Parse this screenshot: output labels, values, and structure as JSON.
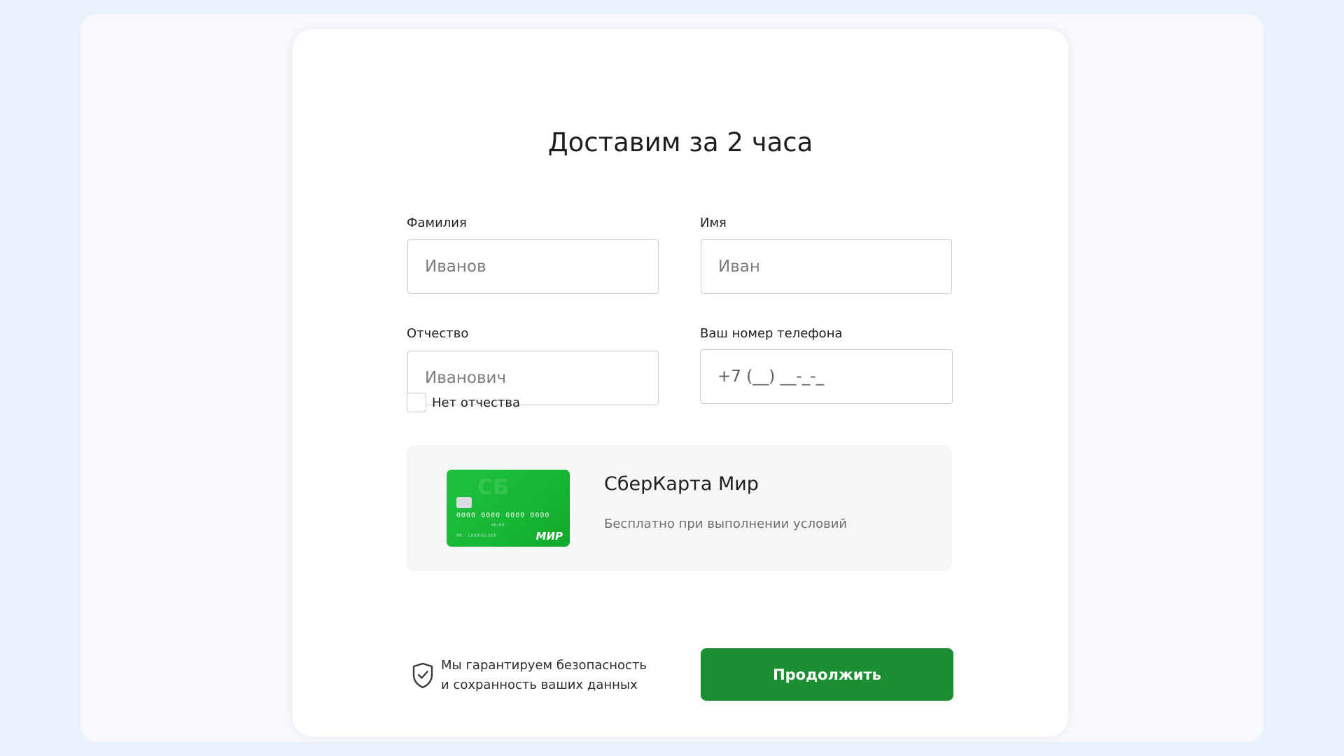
{
  "form": {
    "title": "Доставим за 2 часа",
    "last_name": {
      "label": "Фамилия",
      "placeholder": "Иванов",
      "value": ""
    },
    "first_name": {
      "label": "Имя",
      "placeholder": "Иван",
      "value": ""
    },
    "middle_name": {
      "label": "Отчество",
      "placeholder": "Иванович",
      "value": ""
    },
    "phone": {
      "label": "Ваш номер телефона",
      "placeholder": "+7 (__) __-_-_",
      "value": ""
    },
    "no_middle_name": {
      "label": "Нет отчества",
      "checked": false
    }
  },
  "promo": {
    "title": "СберКарта Мир",
    "subtitle": "Бесплатно при выполнении условий",
    "card": {
      "logo_mark": "СБ",
      "number": "0000  0000  0000  0000",
      "expiry": "00/00",
      "holder": "MR. CARDHOLDER",
      "brand": "МИР",
      "color": "#1fc23e"
    }
  },
  "footer": {
    "security_icon": "shield-check-icon",
    "security_line1": "Мы гарантируем безопасность",
    "security_line2": "и сохранность ваших данных",
    "continue_label": "Продолжить"
  },
  "colors": {
    "primary_button": "#1a8e30",
    "page_background": "#ebf1fb",
    "promo_background": "#f6f6f7"
  }
}
